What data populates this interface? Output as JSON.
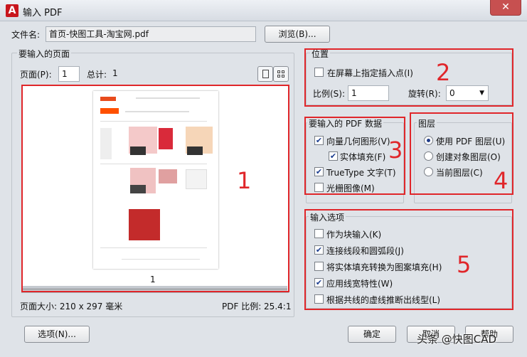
{
  "window": {
    "title": "输入 PDF",
    "close_glyph": "✕"
  },
  "file": {
    "label": "文件名:",
    "value": "首页-快图工具-淘宝网.pdf",
    "browse_label": "浏览(B)..."
  },
  "pages": {
    "group_title": "要输入的页面",
    "page_label": "页面(P):",
    "page_value": "1",
    "total_label": "总计:",
    "total_value": "1",
    "thumb_caption": "1",
    "page_size": "页面大小: 210 x 297 毫米",
    "pdf_scale": "PDF 比例: 25.4:1"
  },
  "location": {
    "title": "位置",
    "insert_point_label": "在屏幕上指定插入点(I)",
    "insert_point_checked": false,
    "scale_label": "比例(S):",
    "scale_value": "1",
    "rotation_label": "旋转(R):",
    "rotation_value": "0"
  },
  "pdf_data": {
    "title": "要输入的 PDF 数据",
    "items": [
      {
        "label": "向量几何图形(V)",
        "checked": true
      },
      {
        "label": "实体填充(F)",
        "checked": true
      },
      {
        "label": "TrueType 文字(T)",
        "checked": true
      },
      {
        "label": "光栅图像(M)",
        "checked": false
      }
    ]
  },
  "layers": {
    "title": "图层",
    "items": [
      {
        "label": "使用 PDF 图层(U)",
        "selected": true
      },
      {
        "label": "创建对象图层(O)",
        "selected": false
      },
      {
        "label": "当前图层(C)",
        "selected": false
      }
    ]
  },
  "import_options": {
    "title": "输入选项",
    "items": [
      {
        "label": "作为块输入(K)",
        "checked": false
      },
      {
        "label": "连接线段和圆弧段(J)",
        "checked": true
      },
      {
        "label": "将实体填充转换为图案填充(H)",
        "checked": false
      },
      {
        "label": "应用线宽特性(W)",
        "checked": true
      },
      {
        "label": "根据共线的虚线推断出线型(L)",
        "checked": false
      }
    ]
  },
  "buttons": {
    "options": "选项(N)...",
    "ok": "确定",
    "cancel": "取消",
    "help": "帮助"
  },
  "annotations": {
    "n1": "1",
    "n2": "2",
    "n3": "3",
    "n4": "4",
    "n5": "5"
  },
  "watermark": "头条 @快图CAD",
  "colors": {
    "annotation_red": "#e0262a",
    "close_red": "#c75050"
  }
}
